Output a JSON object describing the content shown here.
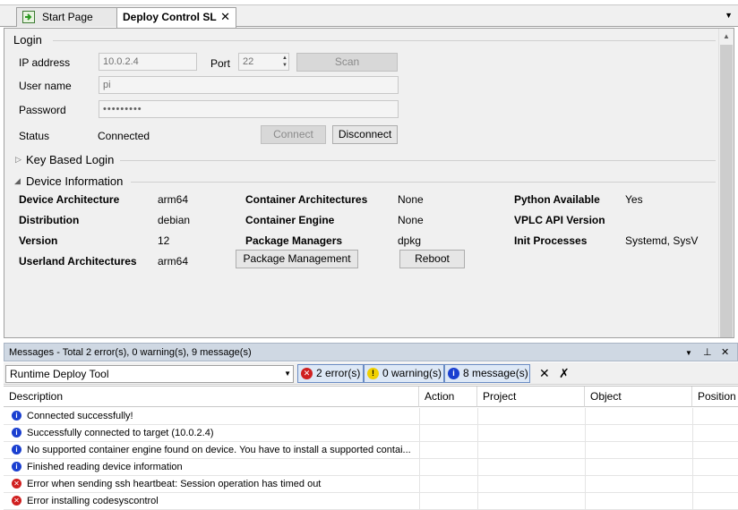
{
  "tabs": {
    "start_label": "Start Page",
    "deploy_label": "Deploy Control SL",
    "close_glyph": "✕"
  },
  "login": {
    "section_title": "Login",
    "ip_label": "IP address",
    "ip_value": "10.0.2.4",
    "port_label": "Port",
    "port_value": "22",
    "scan_label": "Scan",
    "username_label": "User name",
    "username_value": "pi",
    "password_label": "Password",
    "password_value": "•••••••••",
    "status_label": "Status",
    "status_value": "Connected",
    "connect_label": "Connect",
    "disconnect_label": "Disconnect"
  },
  "key_login": {
    "title": "Key Based Login"
  },
  "device": {
    "title": "Device Information",
    "device_architecture_label": "Device Architecture",
    "device_architecture_value": "arm64",
    "distribution_label": "Distribution",
    "distribution_value": "debian",
    "version_label": "Version",
    "version_value": "12",
    "userland_label": "Userland Architectures",
    "userland_value": "arm64",
    "container_arch_label": "Container Architectures",
    "container_arch_value": "None",
    "container_engine_label": "Container Engine",
    "container_engine_value": "None",
    "package_managers_label": "Package Managers",
    "package_managers_value": "dpkg",
    "python_label": "Python Available",
    "python_value": "Yes",
    "vplc_label": "VPLC API Version",
    "vplc_value": "",
    "init_label": "Init Processes",
    "init_value": "Systemd, SysV",
    "package_mgmt_button": "Package Management",
    "reboot_button": "Reboot"
  },
  "messages": {
    "title": "Messages - Total 2 error(s), 0 warning(s), 9 message(s)",
    "source": "Runtime Deploy Tool",
    "errors_filter": "2 error(s)",
    "warnings_filter": "0 warning(s)",
    "messages_filter": "8 message(s)",
    "columns": [
      "Description",
      "Action",
      "Project",
      "Object",
      "Position"
    ],
    "rows": [
      {
        "type": "info",
        "text": "Connected successfully!"
      },
      {
        "type": "info",
        "text": "Successfully connected to target (10.0.2.4)"
      },
      {
        "type": "info",
        "text": "No supported container engine found on device. You have to install a supported contai..."
      },
      {
        "type": "info",
        "text": "Finished reading device information"
      },
      {
        "type": "error",
        "text": "Error when sending ssh heartbeat: Session operation has timed out"
      },
      {
        "type": "error",
        "text": "Error installing codesyscontrol"
      }
    ]
  },
  "colors": {
    "info": "#1a3fd0",
    "error": "#d02020",
    "warning": "#f0d000",
    "panel_title_bg": "#cfd8e3"
  },
  "icons": [
    "start-page-icon",
    "close-icon",
    "chevron-down-icon",
    "expand-triangle-icon",
    "collapse-triangle-icon",
    "info-icon",
    "error-icon",
    "warning-icon",
    "clear-icon",
    "clear-all-icon",
    "pin-icon"
  ]
}
